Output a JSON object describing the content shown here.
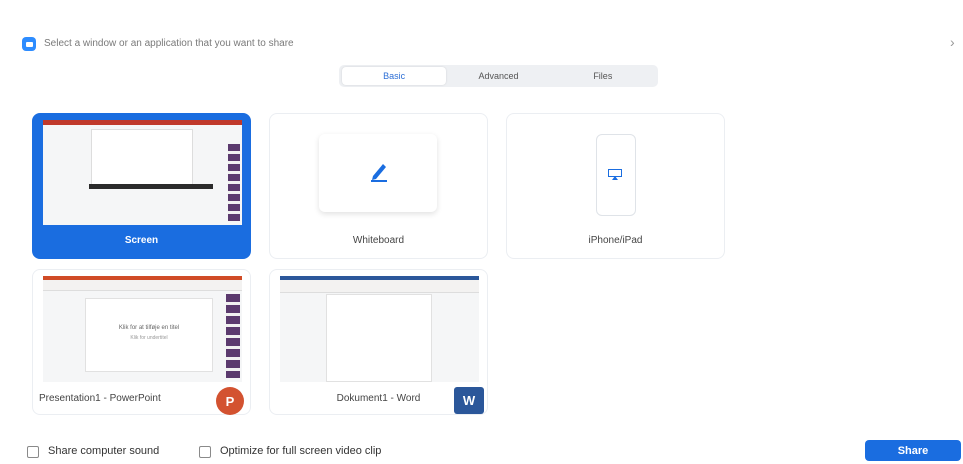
{
  "header": {
    "title": "Select a window or an application that you want to share",
    "close_glyph": "›"
  },
  "tabs": [
    {
      "label": "Basic",
      "active": true
    },
    {
      "label": "Advanced",
      "active": false
    },
    {
      "label": "Files",
      "active": false
    }
  ],
  "cards": {
    "screen": {
      "label": "Screen",
      "selected": true
    },
    "whiteboard": {
      "label": "Whiteboard",
      "icon": "pencil-icon"
    },
    "iphone": {
      "label": "iPhone/iPad",
      "icon": "airplay-icon"
    },
    "powerpoint": {
      "label": "Presentation1 - PowerPoint",
      "badge": "P",
      "slide_title": "Klik for at tilføje en titel",
      "slide_subtitle": "Klik for undertitel"
    },
    "word": {
      "label": "Dokument1 - Word",
      "badge": "W"
    }
  },
  "footer": {
    "share_sound_label": "Share computer sound",
    "optimize_label": "Optimize for full screen video clip",
    "share_button": "Share"
  },
  "colors": {
    "accent": "#1a6de0",
    "powerpoint": "#d35230",
    "word": "#2b579a"
  }
}
